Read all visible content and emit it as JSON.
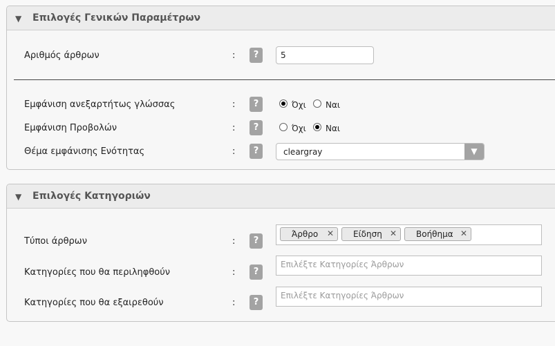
{
  "general": {
    "title": "Επιλογές Γενικών Παραμέτρων",
    "toggle_icon": "triangle-down-icon",
    "num_articles_label": "Αριθμός άρθρων",
    "num_articles_value": "5",
    "lang_label": "Εμφάνιση ανεξαρτήτως γλώσσας",
    "lang_no": "Όχι",
    "lang_yes": "Ναι",
    "lang_selected": "Όχι",
    "views_label": "Εμφάνιση Προβολών",
    "views_no": "Όχι",
    "views_yes": "Ναι",
    "views_selected": "Ναι",
    "theme_label": "Θέμα εμφάνισης Ενότητας",
    "theme_value": "cleargray"
  },
  "categories": {
    "title": "Επιλογές Κατηγοριών",
    "toggle_icon": "triangle-down-icon",
    "types_label": "Τύποι άρθρων",
    "types_tags": [
      "Άρθρο",
      "Είδηση",
      "Βοήθημα"
    ],
    "include_label": "Κατηγορίες που θα περιληφθούν",
    "include_placeholder": "Επιλέξτε Κατηγορίες Άρθρων",
    "exclude_label": "Κατηγορίες που θα εξαιρεθούν",
    "exclude_placeholder": "Επιλέξτε Κατηγορίες Άρθρων"
  },
  "common": {
    "colon": ":",
    "help": "?"
  }
}
